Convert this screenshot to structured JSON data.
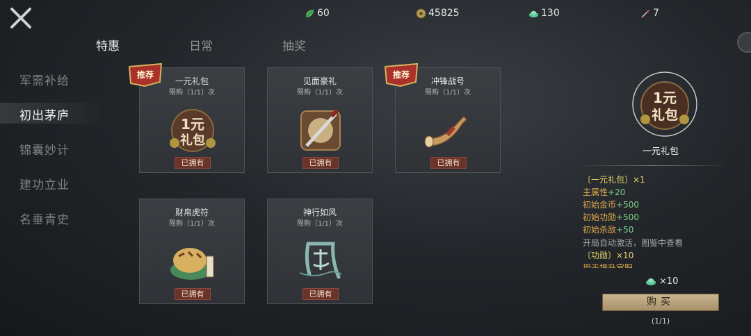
{
  "resources": [
    {
      "icon": "jade-leaf-icon",
      "value": "60"
    },
    {
      "icon": "coin-icon",
      "value": "45825"
    },
    {
      "icon": "green-ingot-icon",
      "value": "130"
    },
    {
      "icon": "arrow-icon",
      "value": "7"
    }
  ],
  "tabs": [
    {
      "label": "特惠",
      "active": true
    },
    {
      "label": "日常",
      "active": false
    },
    {
      "label": "抽奖",
      "active": false
    }
  ],
  "sidebar": [
    {
      "label": "军需补给",
      "active": false
    },
    {
      "label": "初出茅庐",
      "active": true
    },
    {
      "label": "锦囊妙计",
      "active": false
    },
    {
      "label": "建功立业",
      "active": false
    },
    {
      "label": "名垂青史",
      "active": false
    }
  ],
  "cards": [
    {
      "title": "一元礼包",
      "limit": "限购（1/1）次",
      "owned": "已拥有",
      "recommend": "推荐",
      "art": "one-yuan-pack-icon"
    },
    {
      "title": "见面豪礼",
      "limit": "限购（1/1）次",
      "owned": "已拥有",
      "recommend": "",
      "art": "sword-medal-icon"
    },
    {
      "title": "冲锋战号",
      "limit": "限购（1/1）次",
      "owned": "已拥有",
      "recommend": "推荐",
      "art": "war-horn-icon"
    },
    {
      "title": "财帛虎符",
      "limit": "限购（1/1）次",
      "owned": "已拥有",
      "recommend": "",
      "art": "tiger-tally-icon"
    },
    {
      "title": "神行如风",
      "limit": "限购（1/1）次",
      "owned": "已拥有",
      "recommend": "",
      "art": "wind-calligraphy-icon"
    }
  ],
  "detail": {
    "name": "一元礼包",
    "badge_line1": "1元",
    "badge_line2": "礼包",
    "lines": [
      {
        "text": "〔一元礼包〕×1",
        "color": "yellow"
      },
      {
        "text": "主属性+20",
        "color": "orange",
        "accent": "+20"
      },
      {
        "text": "初始金币+500",
        "color": "orange"
      },
      {
        "text": "初始功勋+500",
        "color": "orange"
      },
      {
        "text": "初始杀敌+50",
        "color": "orange"
      },
      {
        "text": "开局自动激活，图鉴中查看",
        "color": "gray"
      },
      {
        "text": "〔功勋〕×10",
        "color": "yellow"
      },
      {
        "text": "用于提升官职",
        "color": "orange"
      }
    ],
    "price": "×10",
    "buy_label": "购买",
    "buy_count": "(1/1)"
  },
  "colors": {
    "accent_gold": "#c9b58f",
    "owned_red": "#6b3428",
    "text_yellow": "#e7d36a"
  }
}
